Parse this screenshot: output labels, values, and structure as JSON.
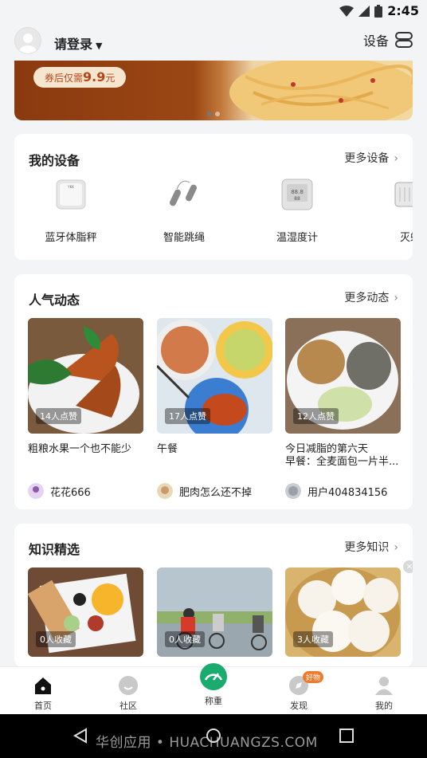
{
  "status_bar": {
    "time": "2:45"
  },
  "header": {
    "login_label": "请登录",
    "devices_label": "设备"
  },
  "banner": {
    "coupon_prefix": "券后仅需",
    "coupon_price": "9.9",
    "coupon_unit": "元"
  },
  "my_devices": {
    "title": "我的设备",
    "more": "更多设备",
    "items": [
      {
        "label": "蓝牙体脂秤",
        "icon": "scale-icon"
      },
      {
        "label": "智能跳绳",
        "icon": "jump-rope-icon"
      },
      {
        "label": "温湿度计",
        "icon": "hygrometer-icon"
      },
      {
        "label": "灭蚊",
        "icon": "mosquito-killer-icon"
      }
    ]
  },
  "feed": {
    "title": "人气动态",
    "more": "更多动态",
    "posts": [
      {
        "likes": "14人点赞",
        "title": "粗粮水果一个也不能少",
        "user": "花花666"
      },
      {
        "likes": "17人点赞",
        "title": "午餐",
        "user": "肥肉怎么还不掉"
      },
      {
        "likes": "12人点赞",
        "title": "今日减脂的第六天\n早餐：全麦面包一片半...",
        "user": "用户404834156"
      }
    ]
  },
  "knowledge": {
    "title": "知识精选",
    "more": "更多知识",
    "items": [
      {
        "saves": "0人收藏"
      },
      {
        "saves": "0人收藏"
      },
      {
        "saves": "3人收藏"
      }
    ]
  },
  "tabbar": {
    "tabs": [
      {
        "label": "首页",
        "icon": "home-icon"
      },
      {
        "label": "社区",
        "icon": "community-icon"
      },
      {
        "label": "称重",
        "icon": "weigh-icon"
      },
      {
        "label": "发现",
        "icon": "discover-icon",
        "badge": "好物"
      },
      {
        "label": "我的",
        "icon": "profile-icon"
      }
    ]
  },
  "navbar": {
    "watermark": "华创应用 • HUACHUANGZS.COM"
  },
  "colors": {
    "accent": "#1aab6e",
    "badge_orange": "#f07a2c"
  }
}
